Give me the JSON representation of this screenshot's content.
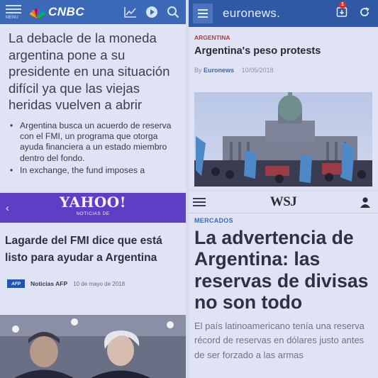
{
  "cnbc": {
    "brand": "CNBC",
    "menu_label": "MENU",
    "headline": "La debacle de la moneda argentina pone a su presidente en una situación difícil ya que las viejas heridas vuelven a abrir",
    "bullets": [
      "Argentina busca un acuerdo de reserva con el FMI, un programa que otorga ayuda financiera a un estado miembro dentro del fondo.",
      "In exchange, the fund imposes a"
    ],
    "icons": [
      "chart-icon",
      "play-icon",
      "search-icon"
    ],
    "colors": {
      "bar": "#3b69b8"
    }
  },
  "euronews": {
    "brand": "euronews.",
    "notification_count": "1",
    "kicker": "ARGENTINA",
    "title": "Argentina's peso protests",
    "by": "By",
    "source": "Euronews",
    "date": "10/05/2018",
    "colors": {
      "bar": "#2f59a4",
      "kicker": "#b03c33"
    }
  },
  "yahoo": {
    "brand": "YAHOO!",
    "brand_sub": "NOTICIAS DE",
    "headline": "Lagarde del FMI dice que está listo para ayudar a Argentina",
    "source_badge": "AFP",
    "source": "Noticias AFP",
    "date": "10 de mayo de 2018",
    "colors": {
      "bar": "#5d3ec4"
    }
  },
  "wsj": {
    "brand": "WSJ",
    "kicker": "MERCADOS",
    "title": "La advertencia de Argentina: las reservas de divisas no son todo",
    "body": "El país latinoamericano tenía una reserva récord de reservas en dólares justo antes de ser forzado a las armas",
    "colors": {
      "kicker": "#3b69b8"
    }
  }
}
